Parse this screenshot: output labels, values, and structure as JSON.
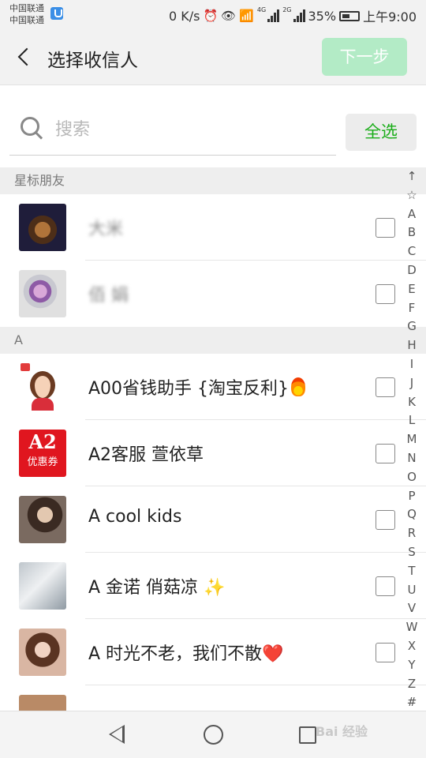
{
  "status_bar": {
    "carrier1": "中国联通",
    "carrier2": "中国联通",
    "speed": "0 K/s",
    "net1": "4G",
    "net2": "2G",
    "battery": "35%",
    "time": "上午9:00"
  },
  "header": {
    "title": "选择收信人",
    "next_label": "下一步"
  },
  "search": {
    "placeholder": "搜索",
    "select_all_label": "全选"
  },
  "sections": [
    {
      "header": "星标朋友",
      "contacts": [
        {
          "name": "大米"
        },
        {
          "name": "佰 娟"
        }
      ]
    },
    {
      "header": "A",
      "contacts": [
        {
          "name": "A00省钱助手 {淘宝反利}"
        },
        {
          "name": "A2客服 萱依草"
        },
        {
          "name": "A cool kids"
        },
        {
          "name": "A 金诺 俏菇凉 ✨"
        },
        {
          "name": "A 时光不老，我们不散❤️"
        }
      ]
    }
  ],
  "avatars": {
    "a2_top": "A2",
    "a2_bottom": "优惠券"
  },
  "index_letters": [
    "↑",
    "☆",
    "A",
    "B",
    "C",
    "D",
    "E",
    "F",
    "G",
    "H",
    "I",
    "J",
    "K",
    "L",
    "M",
    "N",
    "O",
    "P",
    "Q",
    "R",
    "S",
    "T",
    "U",
    "V",
    "W",
    "X",
    "Y",
    "Z",
    "#"
  ],
  "watermark": "Bai 经验",
  "colors": {
    "accent_green": "#1aad19",
    "next_button_disabled": "#b3ebc6"
  }
}
